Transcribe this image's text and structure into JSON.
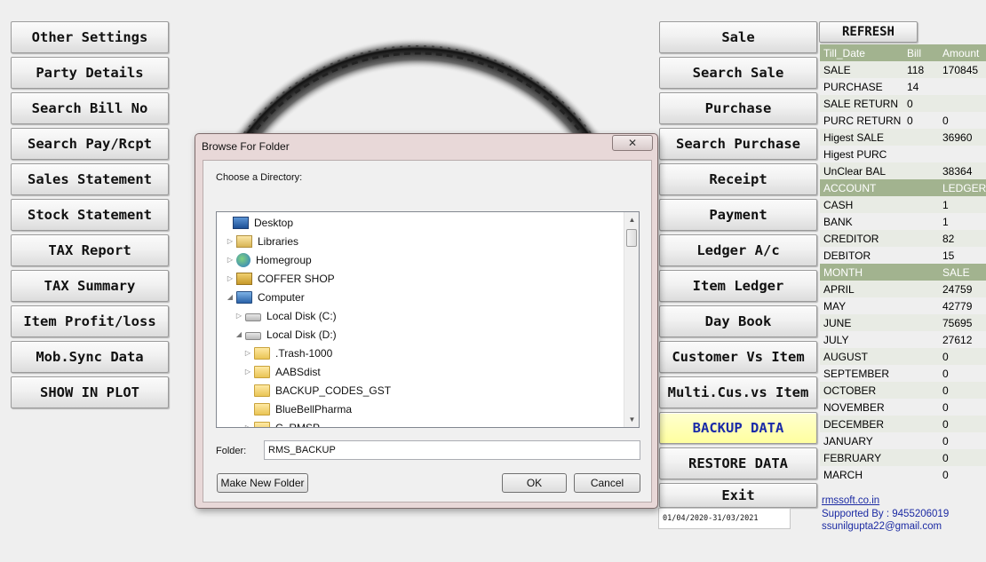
{
  "left_menu": [
    "Other Settings",
    "Party Details",
    "Search Bill No",
    "Search Pay/Rcpt",
    "Sales Statement",
    "Stock Statement",
    "TAX Report",
    "TAX Summary",
    "Item Profit/loss",
    "Mob.Sync Data",
    "SHOW IN PLOT"
  ],
  "right_menu": [
    "Sale",
    "Search Sale",
    "Purchase",
    "Search Purchase",
    "Receipt",
    "Payment",
    "Ledger A/c",
    "Item Ledger",
    "Day Book",
    "Customer Vs Item",
    "Multi.Cus.vs Item",
    "BACKUP DATA",
    "RESTORE DATA",
    "Exit"
  ],
  "refresh_label": "REFRESH",
  "summary": {
    "headers": [
      "Till_Date",
      "Bill",
      "Amount"
    ],
    "rows": [
      [
        "SALE",
        "118",
        "170845"
      ],
      [
        "PURCHASE",
        "14",
        ""
      ],
      [
        "SALE RETURN",
        "0",
        ""
      ],
      [
        "PURC RETURN",
        "0",
        "0"
      ],
      [
        "Higest SALE",
        "",
        "36960"
      ],
      [
        "Higest PURC",
        "",
        ""
      ],
      [
        "UnClear BAL",
        "",
        "38364"
      ]
    ]
  },
  "accounts": {
    "headers": [
      "ACCOUNT",
      "LEDGER"
    ],
    "rows": [
      [
        "CASH",
        "1"
      ],
      [
        "BANK",
        "1"
      ],
      [
        "CREDITOR",
        "82"
      ],
      [
        "DEBITOR",
        "15"
      ]
    ]
  },
  "months": {
    "headers": [
      "MONTH",
      "SALE"
    ],
    "rows": [
      [
        "APRIL",
        "24759"
      ],
      [
        "MAY",
        "42779"
      ],
      [
        "JUNE",
        "75695"
      ],
      [
        "JULY",
        "27612"
      ],
      [
        "AUGUST",
        "0"
      ],
      [
        "SEPTEMBER",
        "0"
      ],
      [
        "OCTOBER",
        "0"
      ],
      [
        "NOVEMBER",
        "0"
      ],
      [
        "DECEMBER",
        "0"
      ],
      [
        "JANUARY",
        "0"
      ],
      [
        "FEBRUARY",
        "0"
      ],
      [
        "MARCH",
        "0"
      ]
    ]
  },
  "date_range": "01/04/2020-31/03/2021",
  "footer": {
    "website": "rmssoft.co.in",
    "support": "Supported By : 9455206019",
    "email": "ssunilgupta22@gmail.com"
  },
  "dialog": {
    "title": "Browse For Folder",
    "close_glyph": "✕",
    "choose_label": "Choose a Directory:",
    "tree": [
      {
        "label": "Desktop",
        "icon": "desktop-icon",
        "expander": ""
      },
      {
        "label": "Libraries",
        "icon": "libraries-icon",
        "expander": "▷"
      },
      {
        "label": "Homegroup",
        "icon": "homegroup-icon",
        "expander": "▷"
      },
      {
        "label": "COFFER SHOP",
        "icon": "user-folder-icon",
        "expander": "▷"
      },
      {
        "label": "Computer",
        "icon": "computer-icon",
        "expander": "◢"
      },
      {
        "label": "Local Disk (C:)",
        "icon": "drive-icon",
        "expander": "▷"
      },
      {
        "label": "Local Disk (D:)",
        "icon": "drive-icon",
        "expander": "◢"
      },
      {
        "label": ".Trash-1000",
        "icon": "folder-icon",
        "expander": "▷"
      },
      {
        "label": "AABSdist",
        "icon": "folder-icon",
        "expander": "▷"
      },
      {
        "label": "BACKUP_CODES_GST",
        "icon": "folder-icon",
        "expander": ""
      },
      {
        "label": "BlueBellPharma",
        "icon": "folder-icon",
        "expander": ""
      },
      {
        "label": "C_RMSP",
        "icon": "folder-icon",
        "expander": "▷"
      }
    ],
    "folder_label": "Folder:",
    "folder_value": "RMS_BACKUP",
    "make_new_folder": "Make New Folder",
    "ok": "OK",
    "cancel": "Cancel"
  }
}
